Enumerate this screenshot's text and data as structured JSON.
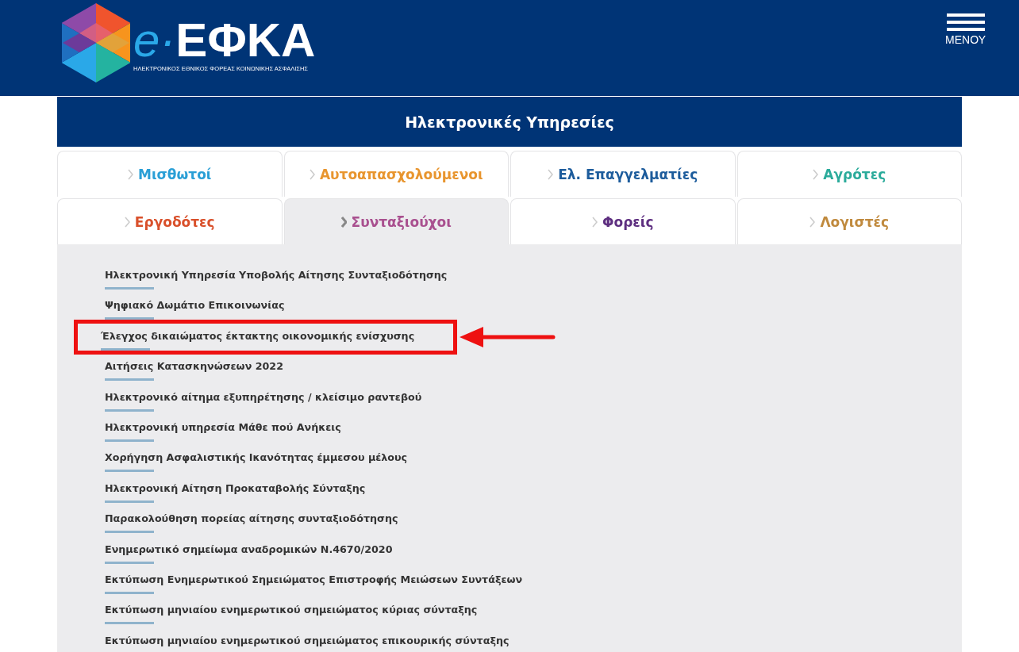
{
  "header": {
    "logo_prefix": "e·",
    "logo_name": "ΕΦΚΑ",
    "logo_subtitle": "ΗΛΕΚΤΡΟΝΙΚΟΣ ΕΘΝΙΚΟΣ ΦΟΡΕΑΣ ΚΟΙΝΩΝΙΚΗΣ ΑΣΦΑΛΙΣΗΣ",
    "menu_label": "ΜΕΝΟΥ"
  },
  "section_title": "Ηλεκτρονικές Υπηρεσίες",
  "tabs": [
    {
      "label": "Μισθωτοί",
      "color": "#2a9fd6",
      "selected": false
    },
    {
      "label": "Αυτοαπασχολούμενοι",
      "color": "#e8952e",
      "selected": false
    },
    {
      "label": "Ελ. Επαγγελματίες",
      "color": "#1d5c9c",
      "selected": false
    },
    {
      "label": "Αγρότες",
      "color": "#2bab9b",
      "selected": false
    },
    {
      "label": "Εργοδότες",
      "color": "#d9502b",
      "selected": false
    },
    {
      "label": "Συνταξιούχοι",
      "color": "#a9508f",
      "selected": true
    },
    {
      "label": "Φορείς",
      "color": "#5e2f80",
      "selected": false
    },
    {
      "label": "Λογιστές",
      "color": "#c08a3e",
      "selected": false
    }
  ],
  "services": [
    {
      "label": "Ηλεκτρονική Υπηρεσία Υποβολής Αίτησης Συνταξιοδότησης",
      "highlighted": false
    },
    {
      "label": "Ψηφιακό Δωμάτιο Επικοινωνίας",
      "highlighted": false
    },
    {
      "label": "Έλεγχος δικαιώματος έκτακτης οικονομικής ενίσχυσης",
      "highlighted": true
    },
    {
      "label": "Αιτήσεις Κατασκηνώσεων 2022",
      "highlighted": false
    },
    {
      "label": "Ηλεκτρονικό αίτημα εξυπηρέτησης / κλείσιμο ραντεβού",
      "highlighted": false
    },
    {
      "label": "Ηλεκτρονική υπηρεσία Μάθε πού Ανήκεις",
      "highlighted": false
    },
    {
      "label": "Χορήγηση Ασφαλιστικής Ικανότητας έμμεσου μέλους",
      "highlighted": false
    },
    {
      "label": "Ηλεκτρονική Αίτηση Προκαταβολής Σύνταξης",
      "highlighted": false
    },
    {
      "label": "Παρακολούθηση πορείας αίτησης συνταξιοδότησης",
      "highlighted": false
    },
    {
      "label": "Ενημερωτικό σημείωμα αναδρομικών Ν.4670/2020",
      "highlighted": false
    },
    {
      "label": "Εκτύπωση Ενημερωτικού Σημειώματος Επιστροφής Μειώσεων Συντάξεων",
      "highlighted": false
    },
    {
      "label": "Εκτύπωση μηνιαίου ενημερωτικού σημειώματος κύριας σύνταξης",
      "highlighted": false
    },
    {
      "label": "Εκτύπωση μηνιαίου ενημερωτικού σημειώματος επικουρικής σύνταξης",
      "highlighted": false
    }
  ]
}
